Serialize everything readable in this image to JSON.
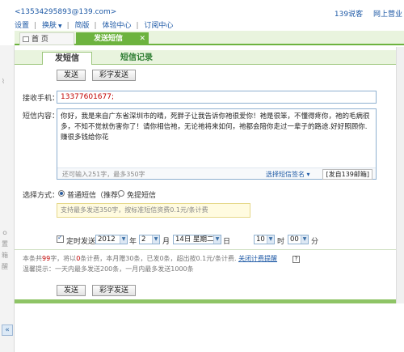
{
  "header": {
    "email": "<13534295893@139.com>",
    "nav": [
      "设置",
      "换肤",
      "简版",
      "体验中心",
      "订阅中心"
    ],
    "nav_suffix": "▼",
    "right_links": [
      "139说客",
      "网上营业"
    ]
  },
  "window_tabs": {
    "home": "首 页",
    "active": "发送短信",
    "close": "✕"
  },
  "subtabs": {
    "send": "发短信",
    "records": "短信记录"
  },
  "toolbar": {
    "send": "发送",
    "mms": "彩字发送"
  },
  "form": {
    "recipient_label": "接收手机：",
    "recipient_value": "13377601677;",
    "message_label": "短信内容：",
    "message_text": "你好，我是来自广东省深圳市的晴，死胖子让我告诉你祂很爱你！祂是很笨，不懂得疼你，祂的毛病很多，不知不觉就伤害你了！请你相信祂，无论祂将来如何，祂都会陪你走过一辈子的路途.好好照顾你.赚很多钱给你花",
    "remaining_prefix": "还可输入",
    "remaining_count": "251",
    "remaining_suffix": "字，最多350字",
    "signature_select": "选择短信签名 ▾",
    "from_label": "[发自139邮箱]",
    "send_method_label": "选择方式：",
    "method_normal": "普通短信（推荐）",
    "method_free": "免提短信",
    "method_hint": "支持最多发送350字，按标准短信资费0.1元/条计费",
    "scheduled_label": "定时发送",
    "year": "2012",
    "year_unit": "年",
    "month": "2",
    "month_unit": "月",
    "day": "14日 星期二",
    "day_unit": "日",
    "hour": "10",
    "hour_unit": "时",
    "minute": "00",
    "minute_unit": "分"
  },
  "info": {
    "line1_a": "本条共",
    "line1_count": "99",
    "line1_b": "字，将以",
    "line1_msgs": "0",
    "line1_c": "条计费，本月赠30条，已发0条，超出按0.1元/条计费.",
    "line1_link": "关闭计费提醒",
    "help": "?",
    "line2": "温馨提示：一天内最多发送200条，一月内最多发送1000条"
  },
  "left_strip": {
    "glyphs": [
      "⌇",
      "ｏ",
      "置",
      "箱",
      "醒"
    ],
    "scroll": "«"
  },
  "colors": {
    "accent_green": "#6db33f",
    "link_blue": "#1f5aa6",
    "recipient_red": "#c00000"
  }
}
